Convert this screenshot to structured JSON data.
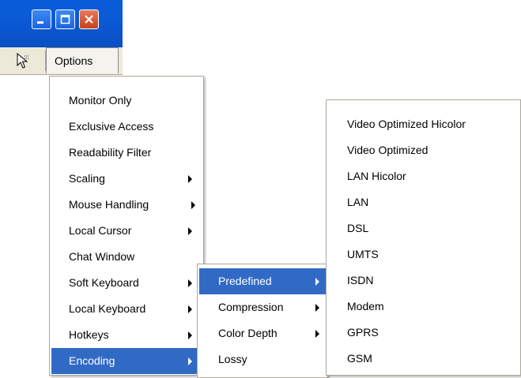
{
  "window": {
    "buttons": [
      "minimize-icon",
      "maximize-icon",
      "close-icon"
    ],
    "title_color": "#0a5cd8"
  },
  "toolbar": {
    "icon": "cursor-icon",
    "options_label": "Options"
  },
  "options_menu": {
    "items": [
      {
        "label": "Monitor Only",
        "submenu": false
      },
      {
        "label": "Exclusive Access",
        "submenu": false
      },
      {
        "label": "Readability Filter",
        "submenu": false
      },
      {
        "label": "Scaling",
        "submenu": true
      },
      {
        "label": "Mouse Handling",
        "submenu": true
      },
      {
        "label": "Local Cursor",
        "submenu": true
      },
      {
        "label": "Chat Window",
        "submenu": false
      },
      {
        "label": "Soft Keyboard",
        "submenu": true
      },
      {
        "label": "Local Keyboard",
        "submenu": true
      },
      {
        "label": "Hotkeys",
        "submenu": true
      },
      {
        "label": "Encoding",
        "submenu": true,
        "selected": true
      }
    ]
  },
  "encoding_menu": {
    "items": [
      {
        "label": "Predefined",
        "submenu": true,
        "selected": true
      },
      {
        "label": "Compression",
        "submenu": true
      },
      {
        "label": "Color Depth",
        "submenu": true
      },
      {
        "label": "Lossy",
        "submenu": false
      }
    ]
  },
  "predefined_menu": {
    "items": [
      {
        "label": "Video Optimized Hicolor"
      },
      {
        "label": "Video Optimized"
      },
      {
        "label": "LAN Hicolor"
      },
      {
        "label": "LAN"
      },
      {
        "label": "DSL"
      },
      {
        "label": "UMTS"
      },
      {
        "label": "ISDN"
      },
      {
        "label": "Modem"
      },
      {
        "label": "GPRS"
      },
      {
        "label": "GSM"
      }
    ]
  },
  "colors": {
    "selection": "#316ac5",
    "toolbar_bg": "#ece9d8",
    "menu_border": "#aca899"
  }
}
